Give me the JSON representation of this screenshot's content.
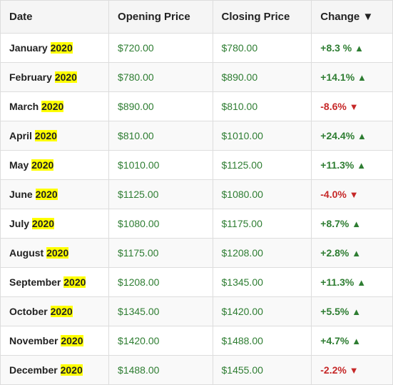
{
  "table": {
    "headers": [
      {
        "key": "date",
        "label": "Date"
      },
      {
        "key": "opening",
        "label": "Opening Price"
      },
      {
        "key": "closing",
        "label": "Closing Price"
      },
      {
        "key": "change",
        "label": "Change ▼"
      }
    ],
    "rows": [
      {
        "month": "January",
        "year": "2020",
        "opening": "$720.00",
        "closing": "$780.00",
        "change": "+8.3 %",
        "direction": "up"
      },
      {
        "month": "February",
        "year": "2020",
        "opening": "$780.00",
        "closing": "$890.00",
        "change": "+14.1%",
        "direction": "up"
      },
      {
        "month": "March",
        "year": "2020",
        "opening": "$890.00",
        "closing": "$810.00",
        "change": "-8.6%",
        "direction": "down"
      },
      {
        "month": "April",
        "year": "2020",
        "opening": "$810.00",
        "closing": "$1010.00",
        "change": "+24.4%",
        "direction": "up"
      },
      {
        "month": "May",
        "year": "2020",
        "opening": "$1010.00",
        "closing": "$1125.00",
        "change": "+11.3%",
        "direction": "up"
      },
      {
        "month": "June",
        "year": "2020",
        "opening": "$1125.00",
        "closing": "$1080.00",
        "change": "-4.0%",
        "direction": "down"
      },
      {
        "month": "July",
        "year": "2020",
        "opening": "$1080.00",
        "closing": "$1175.00",
        "change": "+8.7%",
        "direction": "up"
      },
      {
        "month": "August",
        "year": "2020",
        "opening": "$1175.00",
        "closing": "$1208.00",
        "change": "+2.8%",
        "direction": "up"
      },
      {
        "month": "September",
        "year": "2020",
        "opening": "$1208.00",
        "closing": "$1345.00",
        "change": "+11.3%",
        "direction": "up"
      },
      {
        "month": "October",
        "year": "2020",
        "opening": "$1345.00",
        "closing": "$1420.00",
        "change": "+5.5%",
        "direction": "up"
      },
      {
        "month": "November",
        "year": "2020",
        "opening": "$1420.00",
        "closing": "$1488.00",
        "change": "+4.7%",
        "direction": "up"
      },
      {
        "month": "December",
        "year": "2020",
        "opening": "$1488.00",
        "closing": "$1455.00",
        "change": "-2.2%",
        "direction": "down"
      }
    ]
  }
}
